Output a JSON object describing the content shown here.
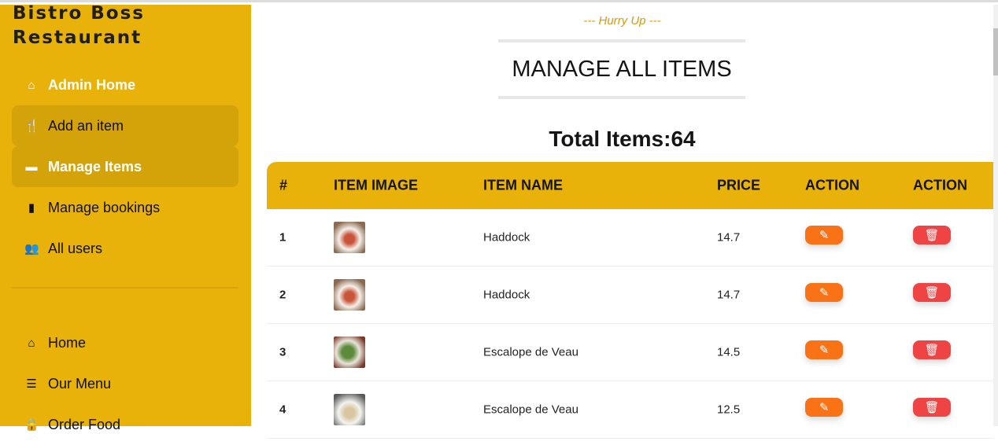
{
  "sidebar": {
    "brand": [
      "Bistro Boss",
      "Restaurant"
    ],
    "admin_items": [
      {
        "label": "Admin Home",
        "icon": "home-icon"
      },
      {
        "label": "Add an item",
        "icon": "utensils-icon"
      },
      {
        "label": "Manage Items",
        "icon": "wallet-icon"
      },
      {
        "label": "Manage bookings",
        "icon": "book-icon"
      },
      {
        "label": "All users",
        "icon": "users-icon"
      }
    ],
    "site_items": [
      {
        "label": "Home",
        "icon": "home-icon"
      },
      {
        "label": "Our Menu",
        "icon": "menu-icon"
      },
      {
        "label": "Order Food",
        "icon": "bag-icon"
      }
    ]
  },
  "main": {
    "subtitle": "--- Hurry Up ---",
    "title": "MANAGE ALL ITEMS",
    "total": "Total Items:64",
    "columns": [
      "#",
      "ITEM IMAGE",
      "ITEM NAME",
      "PRICE",
      "ACTION",
      "ACTION"
    ],
    "rows": [
      {
        "n": "1",
        "name": "Haddock",
        "price": "14.7"
      },
      {
        "n": "2",
        "name": "Haddock",
        "price": "14.7"
      },
      {
        "n": "3",
        "name": "Escalope de Veau",
        "price": "14.5"
      },
      {
        "n": "4",
        "name": "Escalope de Veau",
        "price": "12.5"
      }
    ]
  },
  "colors": {
    "primary": "#E8B20A",
    "edit": "#F97316",
    "delete": "#EF4444",
    "accent_text": "#D99904"
  }
}
